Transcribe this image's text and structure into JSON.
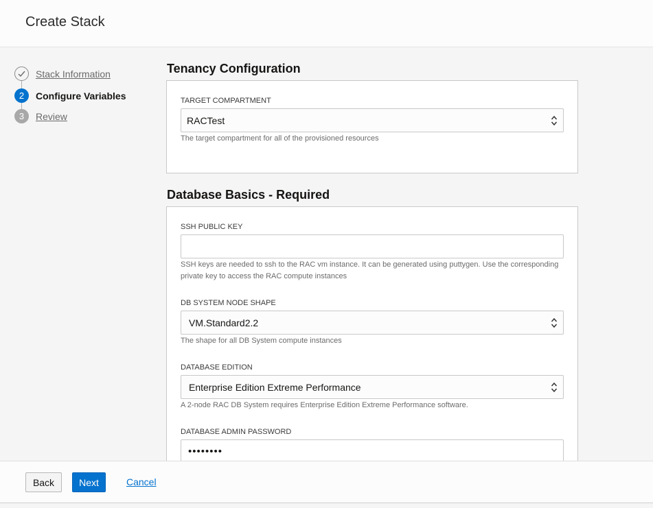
{
  "header": {
    "title": "Create Stack"
  },
  "steps": [
    {
      "number": "",
      "label": "Stack Information",
      "state": "complete"
    },
    {
      "number": "2",
      "label": "Configure Variables",
      "state": "current"
    },
    {
      "number": "3",
      "label": "Review",
      "state": "upcoming"
    }
  ],
  "tenancy": {
    "title": "Tenancy Configuration",
    "compartment": {
      "label": "TARGET COMPARTMENT",
      "value": "RACTest",
      "help": "The target compartment for all of the provisioned resources"
    }
  },
  "database": {
    "title": "Database Basics - Required",
    "ssh_key": {
      "label": "SSH PUBLIC KEY",
      "value": "",
      "help": "SSH keys are needed to ssh to the RAC vm instance. It can be generated using puttygen. Use the corresponding private key to access the RAC compute instances"
    },
    "shape": {
      "label": "DB SYSTEM NODE SHAPE",
      "value": "VM.Standard2.2",
      "help": "The shape for all DB System compute instances"
    },
    "edition": {
      "label": "DATABASE EDITION",
      "value": "Enterprise Edition Extreme Performance",
      "help": "A 2-node RAC DB System requires Enterprise Edition Extreme Performance software."
    },
    "admin_password": {
      "label": "DATABASE ADMIN PASSWORD",
      "value": "••••••••"
    }
  },
  "footer": {
    "back_label": "Back",
    "next_label": "Next",
    "cancel_label": "Cancel"
  },
  "colors": {
    "accent": "#0572ce",
    "step_upcoming": "#a8a8a8"
  },
  "icons": {
    "step_complete": "checkmark-icon",
    "select_arrows": "updown-arrows-icon"
  }
}
